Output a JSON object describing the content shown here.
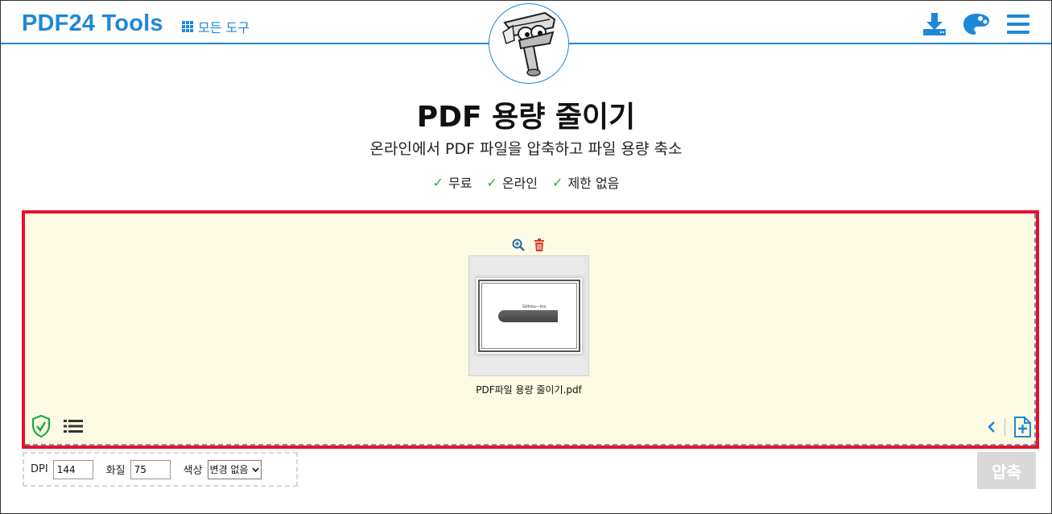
{
  "header": {
    "logo": "PDF24 Tools",
    "all_tools_label": "모든 도구",
    "icons": [
      "download-icon",
      "palette-icon",
      "menu-icon"
    ]
  },
  "hero": {
    "title": "PDF 용량 줄이기",
    "subtitle": "온라인에서 PDF 파일을 압축하고 파일 용량 축소",
    "features": [
      {
        "check": "✓",
        "label": "무료"
      },
      {
        "check": "✓",
        "label": "온라인"
      },
      {
        "check": "✓",
        "label": "제한 없음"
      }
    ]
  },
  "dropzone": {
    "file": {
      "name": "PDF파일 용량 줄이기.pdf",
      "preview_text": "Giltrou—ino"
    },
    "action_icons": [
      "zoom-in-icon",
      "trash-icon"
    ],
    "bottom_left_icons": [
      "shield-check-icon",
      "list-icon"
    ],
    "bottom_right_icons": [
      "chevron-left-icon",
      "add-file-icon"
    ]
  },
  "options": {
    "dpi_label": "DPI",
    "dpi_value": "144",
    "quality_label": "화질",
    "quality_value": "75",
    "color_label": "색상",
    "color_value": "변경 없음"
  },
  "compress_button": "압축",
  "colors": {
    "brand_blue": "#1e88d8",
    "highlight_red": "#e8102b",
    "dropzone_bg": "#fdfbe3",
    "check_green": "#27a844",
    "disabled_button": "#d9d9d9"
  }
}
